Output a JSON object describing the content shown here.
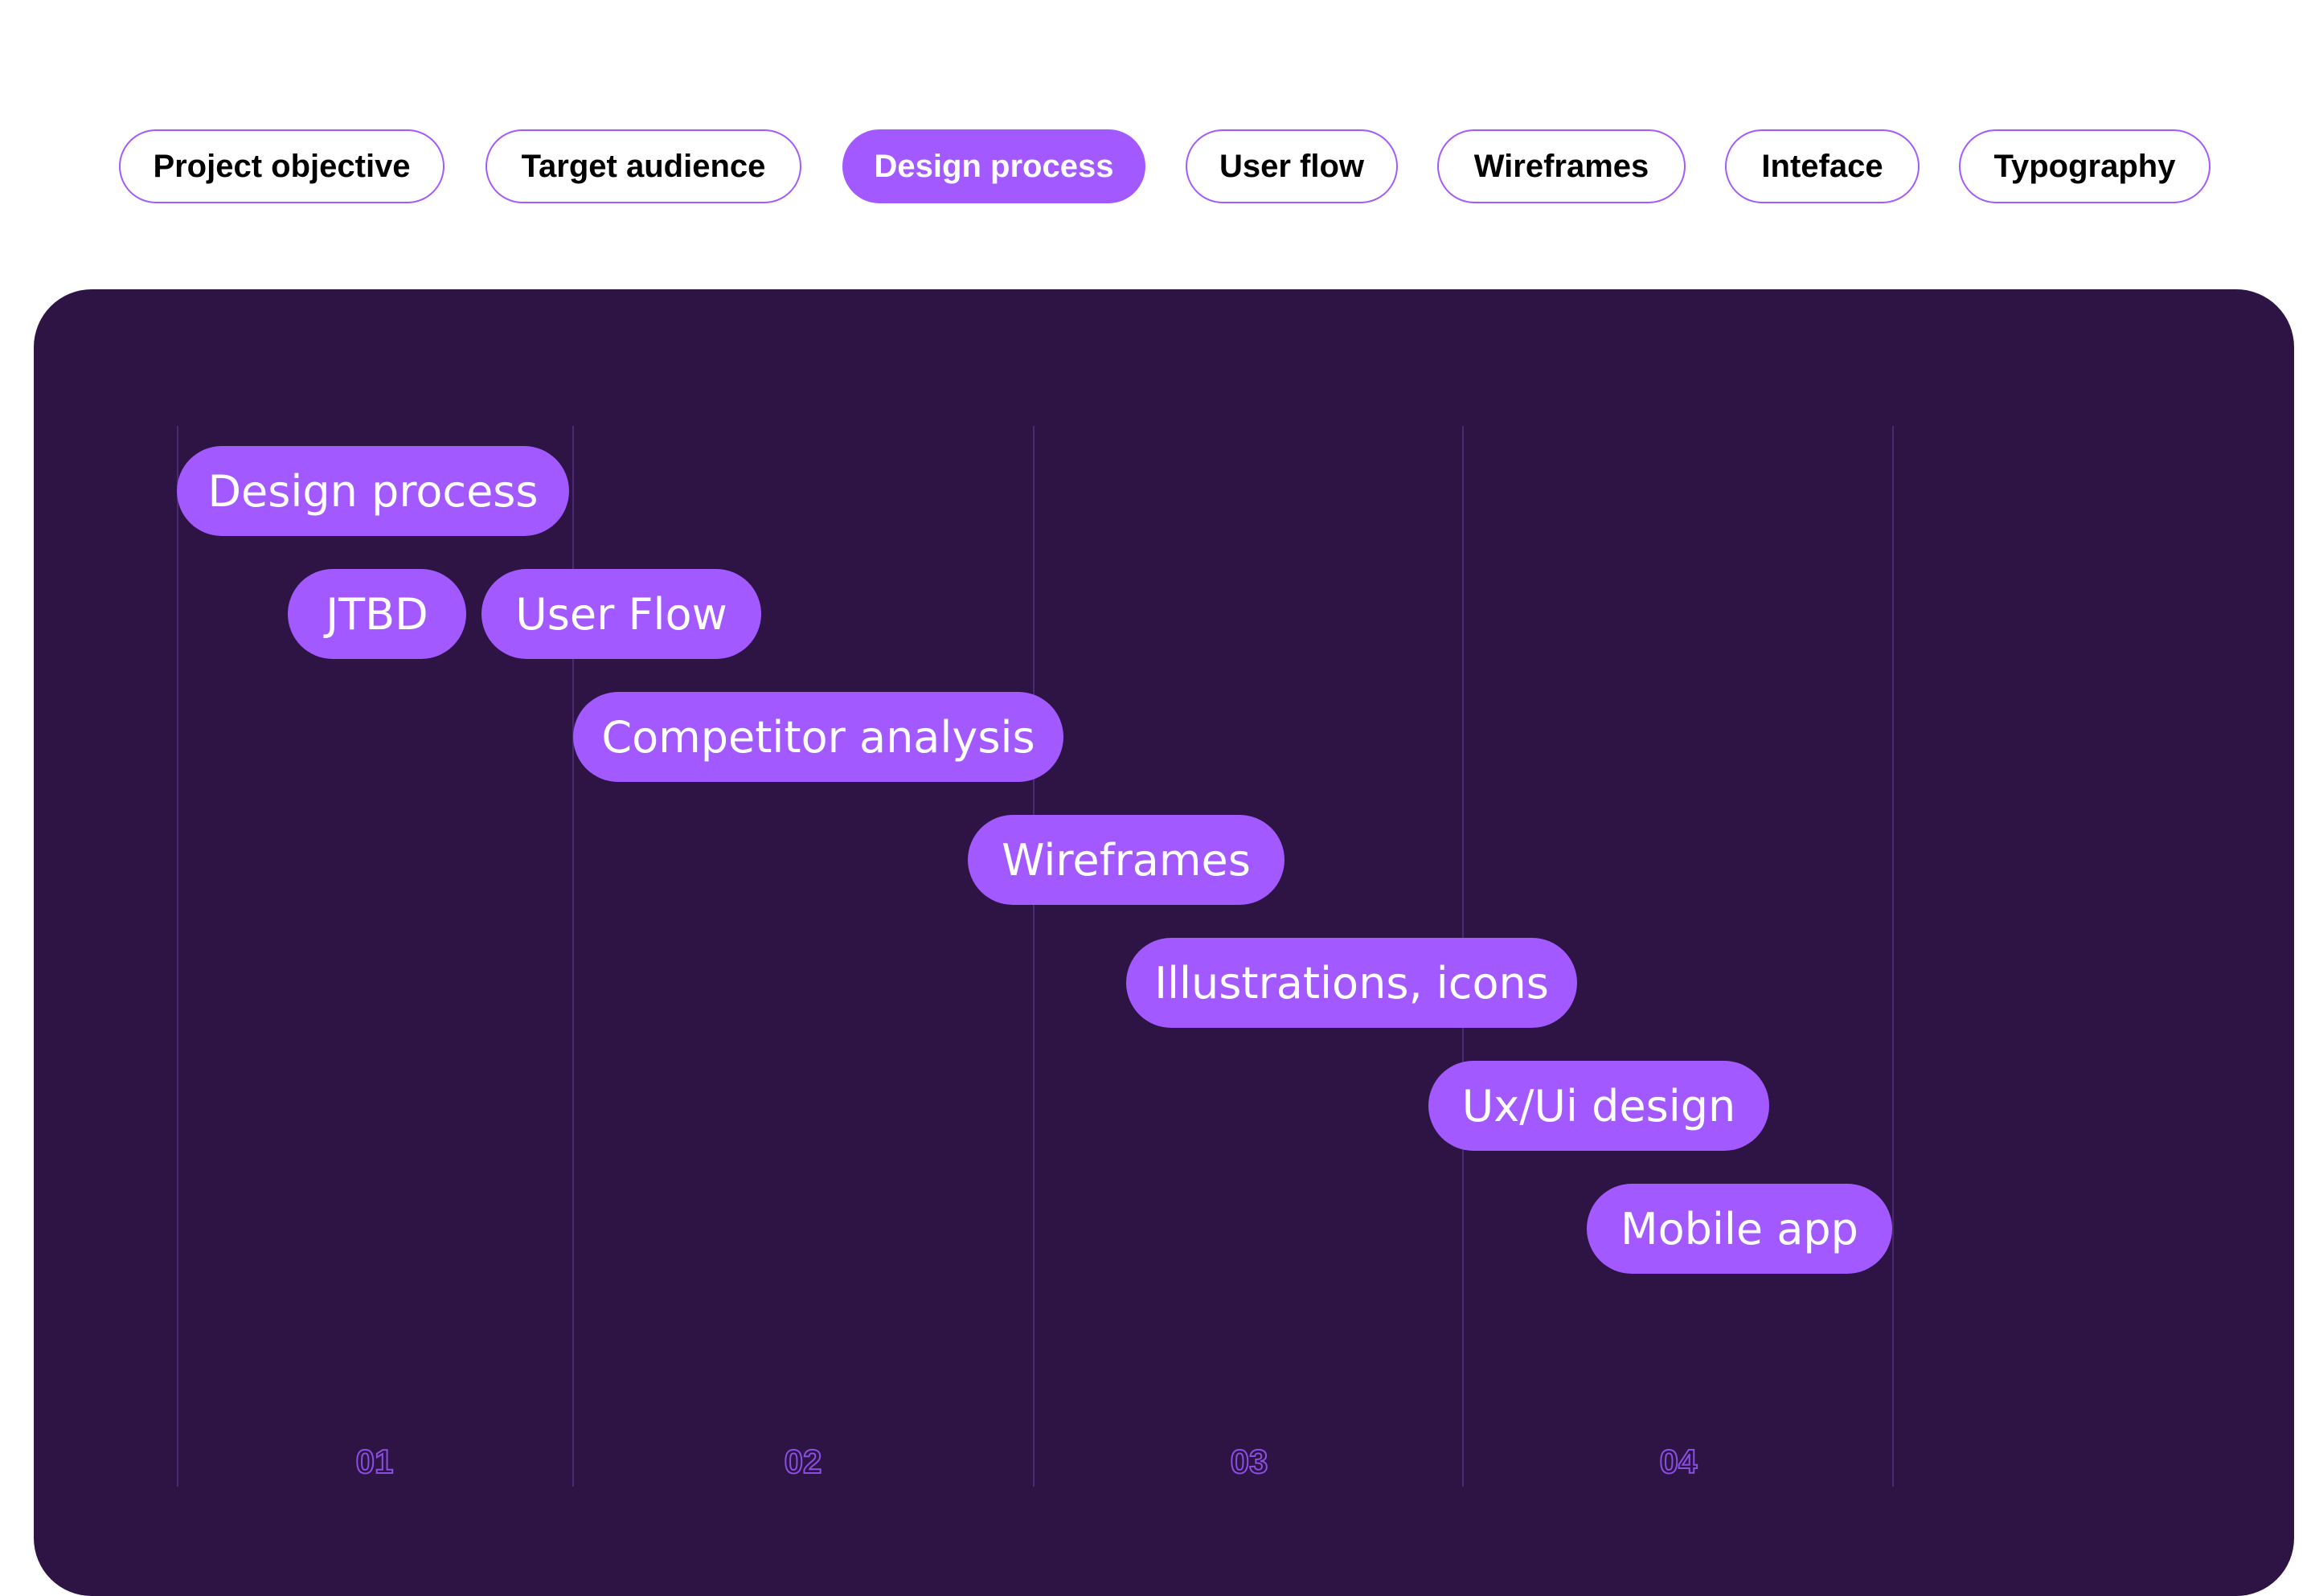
{
  "nav": {
    "tabs": [
      {
        "label": "Project objective",
        "active": false
      },
      {
        "label": "Target audience",
        "active": false
      },
      {
        "label": "Design process",
        "active": true
      },
      {
        "label": "User flow",
        "active": false
      },
      {
        "label": "Wireframes",
        "active": false
      },
      {
        "label": "Inteface",
        "active": false
      },
      {
        "label": "Typography",
        "active": false
      }
    ]
  },
  "timeline": {
    "items": [
      {
        "label": "Design process"
      },
      {
        "label": "JTBD"
      },
      {
        "label": "User Flow"
      },
      {
        "label": "Competitor analysis"
      },
      {
        "label": "Wireframes"
      },
      {
        "label": "Illustrations, icons"
      },
      {
        "label": "Ux/Ui design"
      },
      {
        "label": "Mobile app"
      }
    ],
    "phases": [
      "01",
      "02",
      "03",
      "04"
    ]
  },
  "colors": {
    "accent": "#a259ff",
    "panel_bg": "#2e1445",
    "gridline": "#4a2a73",
    "phase_outline": "#8a4fe0",
    "page_bg": "#ffffff"
  }
}
